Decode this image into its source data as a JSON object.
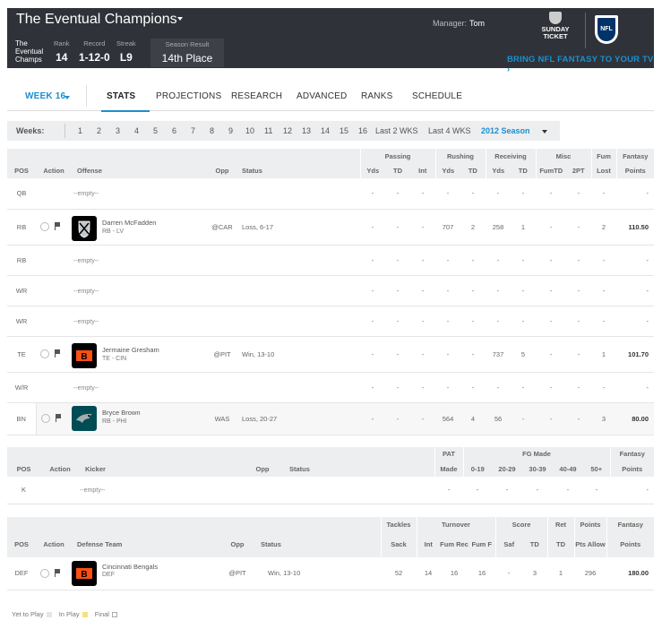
{
  "header": {
    "team_name": "The Eventual Champions",
    "team_logo_alt": "The Eventual Champs",
    "manager_label": "Manager:",
    "manager_name": "Tom",
    "rank_label": "Rank",
    "rank_value": "14",
    "record_label": "Record",
    "record_value": "1-12-0",
    "streak_label": "Streak",
    "streak_value": "L9",
    "season_result_label": "Season Result",
    "season_result_value": "14th Place",
    "sunday_ticket_text": "SUNDAY TICKET",
    "nfl_text": "NFL",
    "promo_text": "BRING NFL FANTASY TO YOUR TV ›"
  },
  "nav": {
    "week": "WEEK 16",
    "tabs": [
      "STATS",
      "PROJECTIONS",
      "RESEARCH",
      "ADVANCED",
      "RANKS",
      "SCHEDULE"
    ],
    "active_tab": "STATS"
  },
  "weeks": {
    "label": "Weeks:",
    "items": [
      "1",
      "2",
      "3",
      "4",
      "5",
      "6",
      "7",
      "8",
      "9",
      "10",
      "11",
      "12",
      "13",
      "14",
      "15",
      "16",
      "Last 2 WKS",
      "Last 4 WKS"
    ],
    "season": "2012 Season"
  },
  "offense": {
    "group_headers": {
      "passing": "Passing",
      "rushing": "Rushing",
      "receiving": "Receiving",
      "misc": "Misc",
      "fum": "Fum",
      "fantasy": "Fantasy"
    },
    "headers": {
      "pos": "POS",
      "action": "Action",
      "player": "Offense",
      "opp": "Opp",
      "status": "Status",
      "pass_yds": "Yds",
      "pass_td": "TD",
      "pass_int": "Int",
      "rush_yds": "Yds",
      "rush_td": "TD",
      "rec_yds": "Yds",
      "rec_td": "TD",
      "fumtd": "FumTD",
      "twopt": "2PT",
      "lost": "Lost",
      "points": "Points"
    },
    "rows": [
      {
        "pos": "QB",
        "empty": "--empty--",
        "dash": "-",
        "lastdash": "-"
      },
      {
        "pos": "RB",
        "name": "Darren McFadden",
        "sub": "RB - LV",
        "opp": "@CAR",
        "status": "Loss, 6-17",
        "vals": [
          "-",
          "-",
          "-",
          "707",
          "2",
          "258",
          "1",
          "-",
          "-",
          "2"
        ],
        "points": "110.50"
      },
      {
        "pos": "RB",
        "empty": "--empty--",
        "dash": "-",
        "lastdash": "-"
      },
      {
        "pos": "WR",
        "empty": "--empty--",
        "dash": "-",
        "lastdash": "-"
      },
      {
        "pos": "WR",
        "empty": "--empty--",
        "dash": "-",
        "lastdash": "-"
      },
      {
        "pos": "TE",
        "name": "Jermaine Gresham",
        "sub": "TE - CIN",
        "opp": "@PIT",
        "status": "Win, 13-10",
        "vals": [
          "-",
          "-",
          "-",
          "-",
          "-",
          "737",
          "5",
          "-",
          "-",
          "1"
        ],
        "points": "101.70"
      },
      {
        "pos": "W/R",
        "empty": "--empty--",
        "dash": "-",
        "lastdash": "-"
      },
      {
        "pos": "BN",
        "name": "Bryce Brown",
        "sub": "RB - PHI",
        "opp": "WAS",
        "status": "Loss, 20-27",
        "vals": [
          "-",
          "-",
          "-",
          "564",
          "4",
          "56",
          "-",
          "-",
          "-",
          "3"
        ],
        "points": "80.00"
      }
    ]
  },
  "kicker": {
    "group_headers": {
      "pat": "PAT",
      "fg": "FG Made",
      "fantasy": "Fantasy"
    },
    "headers": {
      "pos": "POS",
      "action": "Action",
      "player": "Kicker",
      "opp": "Opp",
      "status": "Status",
      "made": "Made",
      "fg1": "0-19",
      "fg2": "20-29",
      "fg3": "30-39",
      "fg4": "40-49",
      "fg5": "50+",
      "points": "Points"
    },
    "row": {
      "pos": "K",
      "empty": "--empty--",
      "dash": "-"
    }
  },
  "defense": {
    "group_headers": {
      "tackles": "Tackles",
      "turnover": "Turnover",
      "score": "Score",
      "ret": "Ret",
      "points_allow": "Points",
      "fantasy": "Fantasy"
    },
    "headers": {
      "pos": "POS",
      "action": "Action",
      "player": "Defense Team",
      "opp": "Opp",
      "status": "Status",
      "sack": "Sack",
      "int": "Int",
      "fumrec": "Fum Rec",
      "fumf": "Fum F",
      "saf": "Saf",
      "td": "TD",
      "rettd": "TD",
      "ptsallow": "Pts Allow",
      "points": "Points"
    },
    "row": {
      "pos": "DEF",
      "name": "Cincinnati Bengals",
      "sub": "DEF",
      "opp": "@PIT",
      "status": "Win, 13-10",
      "vals": [
        "52",
        "14",
        "16",
        "16",
        "-",
        "3",
        "1",
        "296"
      ],
      "points": "180.00"
    }
  },
  "legend": {
    "yet": "Yet to Play",
    "in": "In Play",
    "final": "Final"
  },
  "colors": {
    "accent": "#1a8fd1",
    "header_bg": "#2f3238",
    "in_play": "#f5e27a"
  }
}
